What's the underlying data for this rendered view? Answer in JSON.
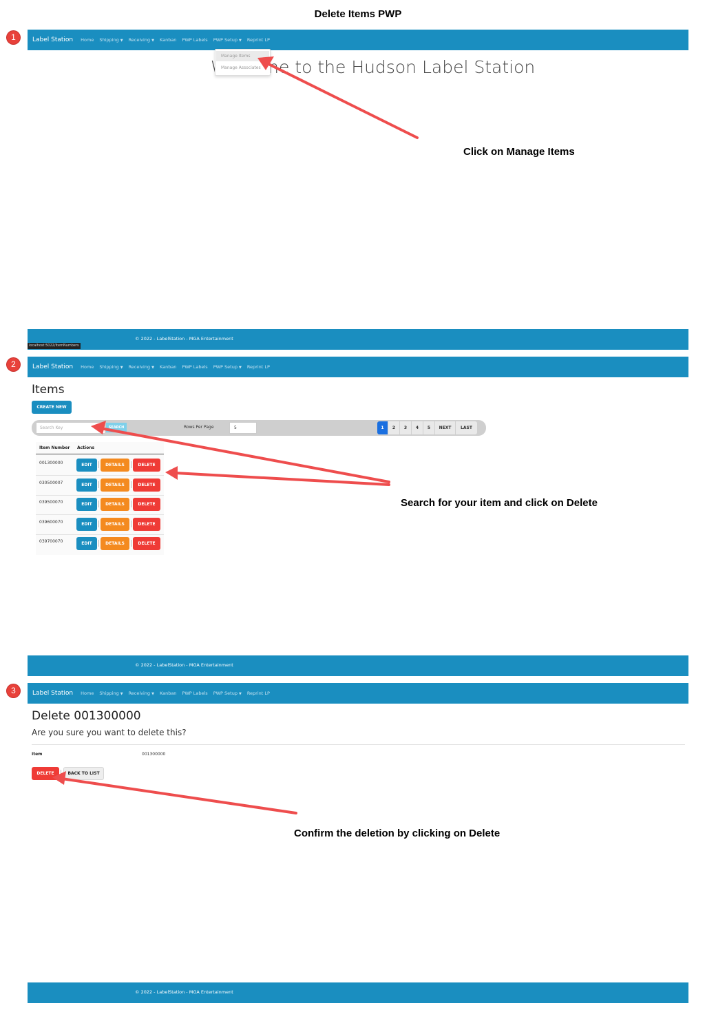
{
  "document": {
    "title": "Delete Items PWP"
  },
  "steps": [
    "1",
    "2",
    "3"
  ],
  "navbar": {
    "brand": "Label Station",
    "items": [
      {
        "label": "Home",
        "dropdown": false
      },
      {
        "label": "Shipping",
        "dropdown": true
      },
      {
        "label": "Receiving",
        "dropdown": true
      },
      {
        "label": "Kanban",
        "dropdown": false
      },
      {
        "label": "PWP Labels",
        "dropdown": false
      },
      {
        "label": "PWP Setup",
        "dropdown": true
      },
      {
        "label": "Reprint LP",
        "dropdown": false
      }
    ]
  },
  "footer": {
    "text": "© 2022 - LabelStation - MGA Entertainment"
  },
  "step1": {
    "dropdown_items": [
      "Manage Items",
      "Manage Associates"
    ],
    "welcome": "Welcome to the Hudson Label Station",
    "callout": "Click on Manage Items",
    "status_url": "localhost:5022/ItemNumbers"
  },
  "step2": {
    "title": "Items",
    "create_new": "CREATE NEW",
    "search": {
      "placeholder": "Search Key",
      "button": "SEARCH"
    },
    "rows_per_page": {
      "label": "Rows Per Page",
      "value": "5"
    },
    "pagination": [
      "1",
      "2",
      "3",
      "4",
      "5",
      "NEXT",
      "LAST"
    ],
    "table": {
      "headers": [
        "Item Number",
        "Actions"
      ],
      "rows": [
        "001300000",
        "030500007",
        "039500070",
        "039600070",
        "039700070"
      ],
      "actions": {
        "edit": "EDIT",
        "details": "DETAILS",
        "delete": "DELETE"
      }
    },
    "callout": "Search for your item and click on Delete"
  },
  "step3": {
    "title": "Delete 001300000",
    "question": "Are you sure you want to delete this?",
    "term": "Item",
    "value": "001300000",
    "delete_button": "DELETE",
    "back_button": "BACK TO LIST",
    "callout": "Confirm the deletion by clicking on Delete"
  },
  "colors": {
    "navbar": "#1a8ec0",
    "edit": "#1a8ec0",
    "details": "#f48a1f",
    "delete": "#ef3b36",
    "arrow": "#ee4d4d",
    "page_active": "#1a6fe0"
  }
}
